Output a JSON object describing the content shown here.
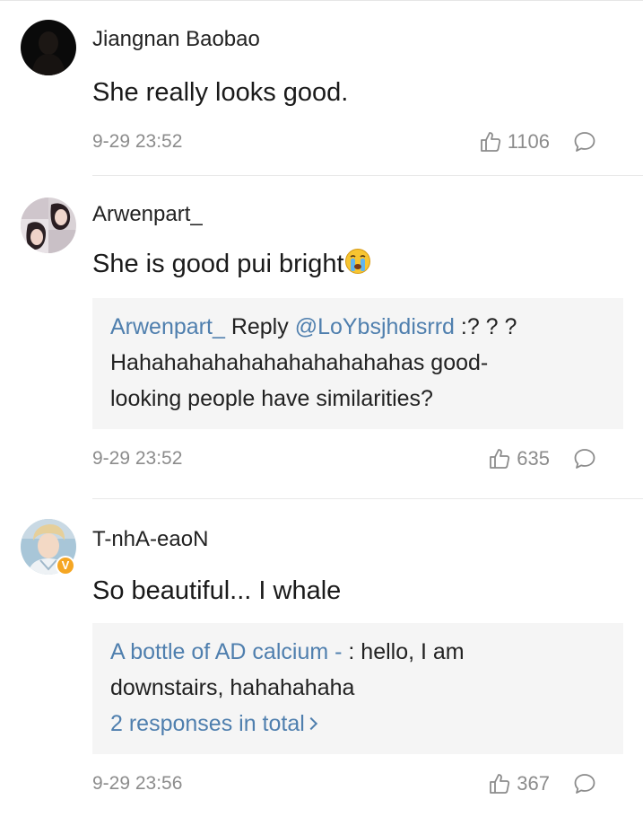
{
  "comments": [
    {
      "username": "Jiangnan Baobao",
      "text": "She really looks good.",
      "time": "9-29 23:52",
      "likes": "1106",
      "avatar_icon": "dark-silhouette-avatar"
    },
    {
      "username": "Arwenpart_",
      "text": "She is good pui bright",
      "emoji": "crying-face",
      "time": "9-29 23:52",
      "likes": "635",
      "avatar_icon": "two-women-photo-avatar",
      "reply": {
        "author": "Arwenpart_",
        "word": "Reply",
        "mention": "@LoYbsjhdisrrd",
        "line1_rest": ":? ? ?",
        "line2": "Hahahahahahahahahahahahas good-",
        "line3": "looking people have similarities?"
      }
    },
    {
      "username": "T-nhA-eaoN",
      "text": "So beautiful... I whale",
      "time": "9-29 23:56",
      "likes": "367",
      "avatar_icon": "young-man-photo-avatar",
      "badge": "V",
      "reply": {
        "author": "A bottle of AD calcium -",
        "line1_rest": ": hello, I am",
        "line2": "downstairs, hahahahaha",
        "more_link": "2 responses in total"
      }
    }
  ],
  "colors": {
    "link": "#4f7fae",
    "meta_gray": "#8c8c8c",
    "reply_bg": "#f5f5f5",
    "badge": "#f5a623"
  }
}
